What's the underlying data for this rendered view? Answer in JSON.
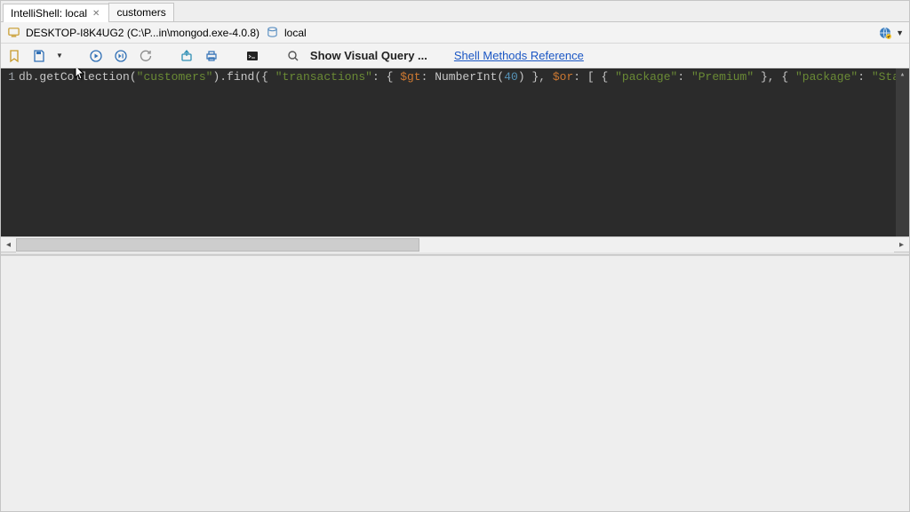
{
  "tabs": [
    {
      "label": "IntelliShell: local",
      "active": true,
      "closable": true
    },
    {
      "label": "customers",
      "active": false,
      "closable": false
    }
  ],
  "pathbar": {
    "host": "DESKTOP-I8K4UG2 (C:\\P...in\\mongod.exe-4.0.8)",
    "db": "local"
  },
  "toolbar": {
    "visual_query_label": "Show Visual Query ...",
    "shell_ref_label": "Shell Methods Reference"
  },
  "editor": {
    "line_number": "1",
    "code_tokens": [
      {
        "t": "db",
        "c": "tok-kw"
      },
      {
        "t": ".",
        "c": "tok-kw"
      },
      {
        "t": "getCollection",
        "c": "tok-fn"
      },
      {
        "t": "(",
        "c": "tok-br"
      },
      {
        "t": "\"customers\"",
        "c": "tok-str"
      },
      {
        "t": ")",
        "c": "tok-br"
      },
      {
        "t": ".",
        "c": "tok-kw"
      },
      {
        "t": "find",
        "c": "tok-fn"
      },
      {
        "t": "(",
        "c": "tok-br"
      },
      {
        "t": "{ ",
        "c": "tok-br"
      },
      {
        "t": "\"transactions\"",
        "c": "tok-str"
      },
      {
        "t": ": ",
        "c": "tok-kw"
      },
      {
        "t": "{ ",
        "c": "tok-br"
      },
      {
        "t": "$gt",
        "c": "tok-op"
      },
      {
        "t": ": ",
        "c": "tok-kw"
      },
      {
        "t": "NumberInt",
        "c": "tok-fn"
      },
      {
        "t": "(",
        "c": "tok-br"
      },
      {
        "t": "40",
        "c": "tok-num"
      },
      {
        "t": ") ",
        "c": "tok-br"
      },
      {
        "t": "}",
        "c": "tok-br"
      },
      {
        "t": ", ",
        "c": "tok-kw"
      },
      {
        "t": "$or",
        "c": "tok-op"
      },
      {
        "t": ": ",
        "c": "tok-kw"
      },
      {
        "t": "[ ",
        "c": "tok-br"
      },
      {
        "t": "{ ",
        "c": "tok-br"
      },
      {
        "t": "\"package\"",
        "c": "tok-str"
      },
      {
        "t": ": ",
        "c": "tok-kw"
      },
      {
        "t": "\"Premium\"",
        "c": "tok-str"
      },
      {
        "t": " }",
        "c": "tok-br"
      },
      {
        "t": ", ",
        "c": "tok-kw"
      },
      {
        "t": "{ ",
        "c": "tok-br"
      },
      {
        "t": "\"package\"",
        "c": "tok-str"
      },
      {
        "t": ": ",
        "c": "tok-kw"
      },
      {
        "t": "\"Standard\"",
        "c": "tok-str"
      },
      {
        "t": " }",
        "c": "tok-br"
      }
    ]
  }
}
